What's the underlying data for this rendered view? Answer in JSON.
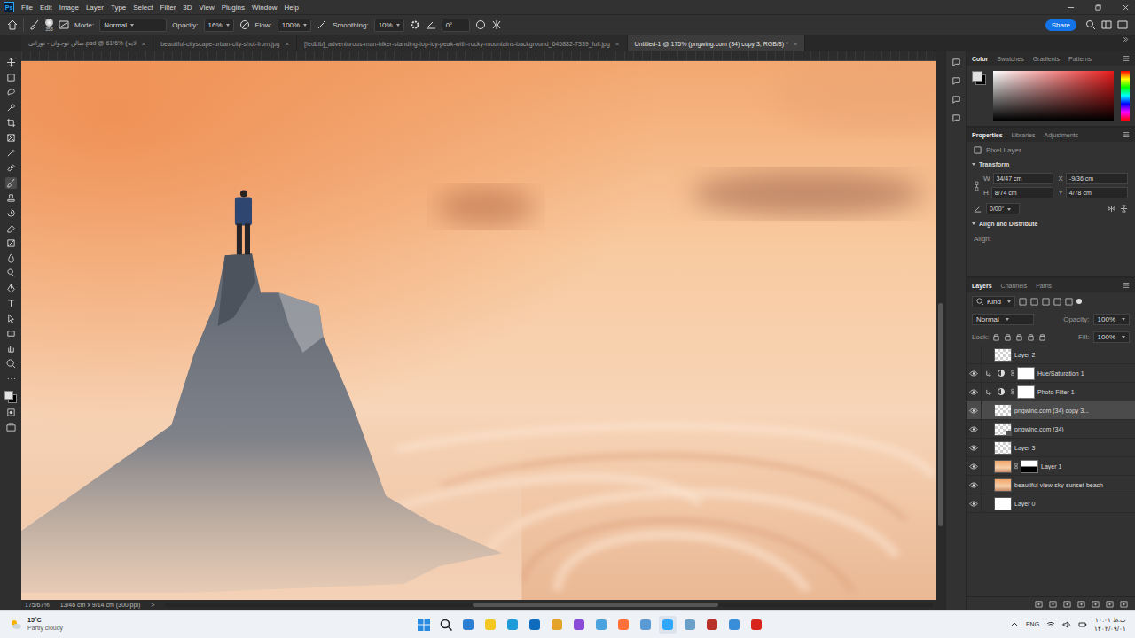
{
  "app": {
    "logo": "Ps",
    "menu": [
      "File",
      "Edit",
      "Image",
      "Layer",
      "Type",
      "Select",
      "Filter",
      "3D",
      "View",
      "Plugins",
      "Window",
      "Help"
    ],
    "share": "Share"
  },
  "options": {
    "brush_size": "353",
    "mode_label": "Mode:",
    "mode": "Normal",
    "opacity_label": "Opacity:",
    "opacity": "16%",
    "flow_label": "Flow:",
    "flow": "100%",
    "smoothing_label": "Smoothing:",
    "smoothing": "10%",
    "angle": "0°"
  },
  "doc_tabs": [
    {
      "label": "سالن نوجوان - نورانی.psd @ 61/6% (لایه",
      "selected": false,
      "close": "×"
    },
    {
      "label": "beautiful-cityscape-urban-city-shot-from.jpg",
      "selected": false,
      "close": "×"
    },
    {
      "label": "[fedLib]_adventurous-man-hiker-standing-top-icy-peak-with-rocky-mountains-background_645882-7339_full.jpg",
      "selected": false,
      "close": "×"
    },
    {
      "label": "Untitled-1 @ 175% (pngwing.com (34) copy 3, RGB/8) *",
      "selected": true,
      "close": "×"
    }
  ],
  "color_panel": {
    "tabs": [
      {
        "label": "Color",
        "selected": true
      },
      {
        "label": "Swatches",
        "selected": false
      },
      {
        "label": "Gradients",
        "selected": false
      },
      {
        "label": "Patterns",
        "selected": false
      }
    ]
  },
  "properties": {
    "tabs": [
      {
        "label": "Properties",
        "selected": true
      },
      {
        "label": "Libraries",
        "selected": false
      },
      {
        "label": "Adjustments",
        "selected": false
      }
    ],
    "layer_type": "Pixel Layer",
    "section": "Transform",
    "fields": [
      {
        "label": "W",
        "value": "34/47 cm"
      },
      {
        "label": "X",
        "value": "-9/36 cm"
      },
      {
        "label": "H",
        "value": "8/74 cm"
      },
      {
        "label": "Y",
        "value": "4/78 cm"
      }
    ],
    "angle": "0/00°",
    "align_section": "Align and Distribute",
    "align_label": "Align:"
  },
  "layers_panel": {
    "tabs": [
      {
        "label": "Layers",
        "selected": true
      },
      {
        "label": "Channels",
        "selected": false
      },
      {
        "label": "Paths",
        "selected": false
      }
    ],
    "filter": "Kind",
    "blend": "Normal",
    "opacity_label": "Opacity:",
    "opacity": "100%",
    "lock_label": "Lock:",
    "fill_label": "Fill:",
    "fill": "100%",
    "layers": [
      {
        "name": "Layer 2",
        "visible": false,
        "selected": false,
        "kind": "pixel",
        "clipped": false,
        "mask": "none"
      },
      {
        "name": "Hue/Saturation 1",
        "visible": true,
        "selected": false,
        "kind": "adjustment",
        "clipped": true,
        "mask": "white"
      },
      {
        "name": "Photo Filter 1",
        "visible": true,
        "selected": false,
        "kind": "adjustment",
        "clipped": true,
        "mask": "white"
      },
      {
        "name": "pngwing.com (34) copy 3...",
        "visible": true,
        "selected": true,
        "kind": "pixel",
        "clipped": false,
        "mask": "none"
      },
      {
        "name": "pngwing.com (34)",
        "visible": true,
        "selected": false,
        "kind": "smart",
        "clipped": false,
        "mask": "none"
      },
      {
        "name": "Layer 3",
        "visible": true,
        "selected": false,
        "kind": "pixel",
        "clipped": false,
        "mask": "none"
      },
      {
        "name": "Layer 1",
        "visible": true,
        "selected": false,
        "kind": "photo",
        "clipped": false,
        "mask": "partial"
      },
      {
        "name": "beautiful-view-sky-sunset-beach",
        "visible": true,
        "selected": false,
        "kind": "photo",
        "clipped": false,
        "mask": "none"
      },
      {
        "name": "Layer 0",
        "visible": true,
        "selected": false,
        "kind": "white",
        "clipped": false,
        "mask": "none"
      }
    ]
  },
  "status_bar": {
    "zoom": "175/67%",
    "size": "13/46 cm x 9/14 cm (300 ppi)",
    "arrow": ">"
  },
  "taskbar": {
    "temp": "15°C",
    "weather": "Partly cloudy",
    "lang": "ENG",
    "time": "۱۰:۰۱ ب.ظ",
    "date": "۱۴۰۲/۰۹/۰۱"
  }
}
